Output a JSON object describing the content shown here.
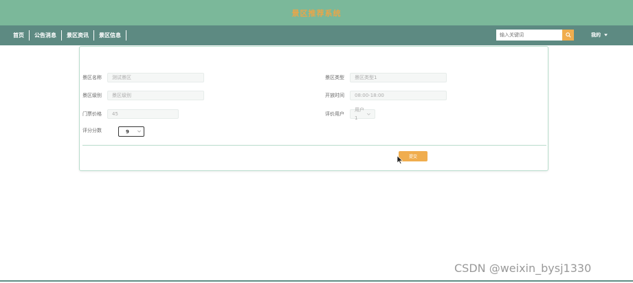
{
  "header": {
    "title": "景区推荐系统"
  },
  "nav": {
    "items": [
      {
        "label": "首页"
      },
      {
        "label": "公告消息"
      },
      {
        "label": "景区资讯"
      },
      {
        "label": "景区信息"
      }
    ]
  },
  "search": {
    "placeholder": "输入关键词"
  },
  "user_menu": {
    "label": "我的"
  },
  "form": {
    "name": {
      "label": "景区名称",
      "value": "测试景区"
    },
    "type": {
      "label": "景区类型",
      "value": "景区类型1"
    },
    "level": {
      "label": "景区级别",
      "value": "景区级别"
    },
    "open_time": {
      "label": "开放时间",
      "value": "08:00-18:00"
    },
    "price": {
      "label": "门票价格",
      "value": "45"
    },
    "user": {
      "label": "评价用户",
      "value": "用户1"
    },
    "score": {
      "label": "评分分数",
      "value": "9"
    },
    "submit_label": "提交"
  },
  "watermark": "CSDN @weixin_bysj1330",
  "colors": {
    "header": "#7bb89a",
    "nav": "#5d8a82",
    "accent": "#f0ad4e"
  }
}
